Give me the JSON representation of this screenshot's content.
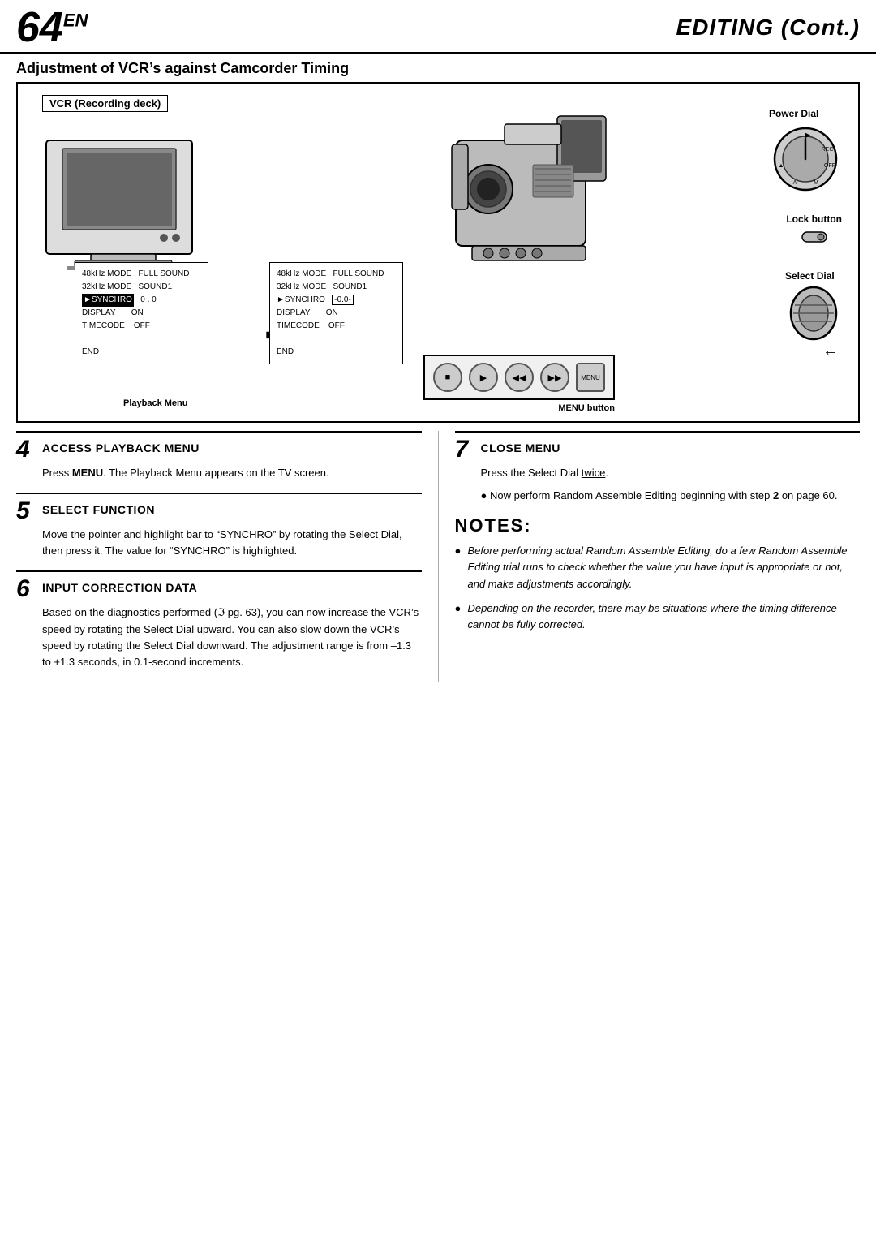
{
  "header": {
    "page_number": "64",
    "page_suffix": "EN",
    "section_title": "EDITING",
    "section_cont": "(Cont.)"
  },
  "subtitle": "Adjustment of VCR’s against Camcorder Timing",
  "diagram": {
    "vcr_label": "VCR (Recording deck)",
    "playback_menu_label": "Playback Menu",
    "menu_button_label": "MENU button",
    "power_dial_label": "Power Dial",
    "lock_button_label": "Lock button",
    "select_dial_label": "Select Dial",
    "menu_left": {
      "rows": [
        "48kHz MODE    FULL SOUND",
        "32kHz MODE    SOUND1",
        "►SYNCHRO       0 . 0",
        "DISPLAY         ON",
        "TIMECODE      OFF",
        "",
        "END"
      ],
      "highlight_row": "SYNCHRO"
    },
    "menu_right": {
      "rows": [
        "48kHz MODE    FULL SOUND",
        "32kHz MODE    SOUND1",
        "►SYNCHRO      -0.0-",
        "DISPLAY         ON",
        "TIMECODE      OFF",
        "",
        "END"
      ],
      "highlight_value": "-0.0-"
    }
  },
  "steps": [
    {
      "number": "4",
      "title": "ACCESS PLAYBACK MENU",
      "body": "Press MENU. The Playback Menu appears on the TV screen.",
      "bold_word": "MENU"
    },
    {
      "number": "5",
      "title": "SELECT FUNCTION",
      "body": "Move the pointer and highlight bar to “SYNCHRO” by rotating the Select Dial, then press it. The value for “SYNCHRO” is highlighted."
    },
    {
      "number": "6",
      "title": "INPUT CORRECTION DATA",
      "body": "Based on the diagnostics performed (ℑ pg. 63), you can now increase the VCR’s speed by rotating the Select Dial upward. You can also slow down the VCR’s speed by rotating the Select Dial downward. The adjustment range is from –1.3 to +1.3 seconds, in 0.1-second increments."
    },
    {
      "number": "7",
      "title": "CLOSE MENU",
      "body": "Press the Select Dial twice.",
      "underline_word": "twice",
      "sub_note": "Now perform Random Assemble Editing beginning with step 2 on page 60.",
      "sub_note_bold": "2"
    }
  ],
  "notes": {
    "title": "NOTES:",
    "items": [
      "Before performing actual Random Assemble Editing, do a few Random Assemble Editing trial runs to check whether the value you have input is appropriate or not, and make adjustments accordingly.",
      "Depending on the recorder, there may be situations where the timing difference cannot be fully corrected."
    ]
  }
}
